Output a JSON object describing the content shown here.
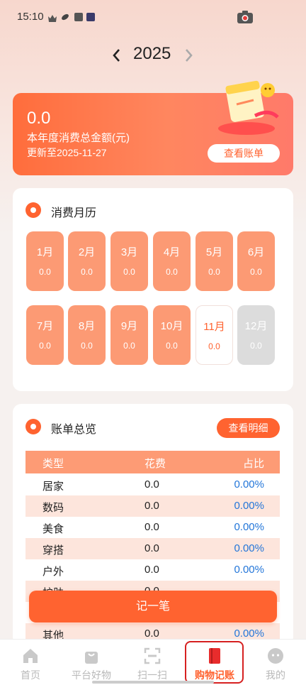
{
  "status_bar": {
    "time": "15:10",
    "icons": [
      "crown-icon",
      "leaf-icon",
      "grid-app-icon",
      "play-icon",
      "camera-icon"
    ]
  },
  "year_nav": {
    "prev_icon": "chevron-left-icon",
    "year": "2025",
    "next_icon": "chevron-right-icon"
  },
  "summary": {
    "total": "0.0",
    "label": "本年度消费总金额(元)",
    "updated": "更新至2025-11-27",
    "view_bill_label": "查看账单",
    "illustration_icon": "calendar-illustration-icon"
  },
  "calendar": {
    "title": "消费月历",
    "months": [
      {
        "label": "1月",
        "value": "0.0",
        "state": "past"
      },
      {
        "label": "2月",
        "value": "0.0",
        "state": "past"
      },
      {
        "label": "3月",
        "value": "0.0",
        "state": "past"
      },
      {
        "label": "4月",
        "value": "0.0",
        "state": "past"
      },
      {
        "label": "5月",
        "value": "0.0",
        "state": "past"
      },
      {
        "label": "6月",
        "value": "0.0",
        "state": "past"
      },
      {
        "label": "7月",
        "value": "0.0",
        "state": "past"
      },
      {
        "label": "8月",
        "value": "0.0",
        "state": "past"
      },
      {
        "label": "9月",
        "value": "0.0",
        "state": "past"
      },
      {
        "label": "10月",
        "value": "0.0",
        "state": "past"
      },
      {
        "label": "11月",
        "value": "0.0",
        "state": "current"
      },
      {
        "label": "12月",
        "value": "0.0",
        "state": "future"
      }
    ]
  },
  "bill_overview": {
    "title": "账单总览",
    "detail_label": "查看明细",
    "columns": [
      "类型",
      "花费",
      "占比"
    ],
    "rows": [
      {
        "type": "居家",
        "cost": "0.0",
        "ratio": "0.00%"
      },
      {
        "type": "数码",
        "cost": "0.0",
        "ratio": "0.00%"
      },
      {
        "type": "美食",
        "cost": "0.0",
        "ratio": "0.00%"
      },
      {
        "type": "穿搭",
        "cost": "0.0",
        "ratio": "0.00%"
      },
      {
        "type": "户外",
        "cost": "0.0",
        "ratio": "0.00%"
      },
      {
        "type": "护肤",
        "cost": "0.0",
        "ratio": ""
      },
      {
        "type": "",
        "cost": "",
        "ratio": ""
      },
      {
        "type": "其他",
        "cost": "0.0",
        "ratio": "0.00%"
      }
    ]
  },
  "record_button": "记一笔",
  "tabbar": {
    "tabs": [
      {
        "label": "首页",
        "icon": "home-icon"
      },
      {
        "label": "平台好物",
        "icon": "shopping-bag-icon"
      },
      {
        "label": "扫一扫",
        "icon": "scan-icon"
      },
      {
        "label": "购物记账",
        "icon": "ledger-book-icon"
      },
      {
        "label": "我的",
        "icon": "profile-icon"
      }
    ],
    "active_index": 3
  },
  "colors": {
    "accent": "#ff6330",
    "month_tile": "#fc9a74",
    "ratio_text": "#2376d9",
    "highlight_border": "#d62020"
  }
}
